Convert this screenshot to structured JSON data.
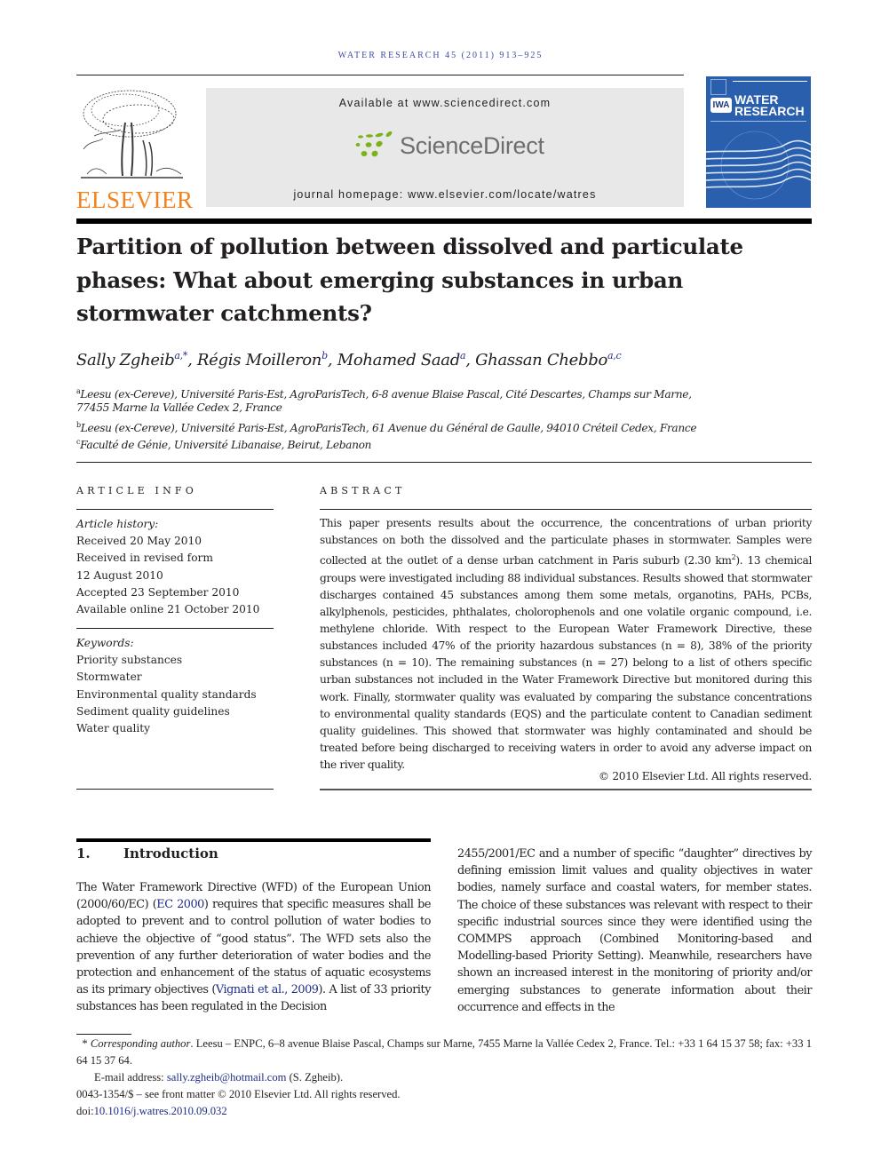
{
  "header": {
    "journal_citation": "WATER RESEARCH 45 (2011) 913–925",
    "available_at": "Available at www.sciencedirect.com",
    "sciencedirect_logo_text": "ScienceDirect",
    "journal_homepage": "journal homepage: www.elsevier.com/locate/watres",
    "publisher_logo_text": "ELSEVIER",
    "cover": {
      "badge": "IWA",
      "title_line1": "WATER",
      "title_line2": "RESEARCH"
    },
    "colors": {
      "elsevier_orange": "#f2821e",
      "sciencedirect_green": "#7ab317",
      "cover_blue": "#2a5fae",
      "link_blue": "#1f2d8a"
    }
  },
  "article": {
    "title": "Partition of pollution between dissolved and particulate phases: What about emerging substances in urban stormwater catchments?",
    "authors": [
      {
        "name": "Sally Zgheib",
        "affil": "a,*"
      },
      {
        "name": "Régis Moilleron",
        "affil": "b"
      },
      {
        "name": "Mohamed Saad",
        "affil": "a"
      },
      {
        "name": "Ghassan Chebbo",
        "affil": "a,c"
      }
    ],
    "affiliations": [
      {
        "mark": "a",
        "line1": "Leesu (ex-Cereve), Université Paris-Est, AgroParisTech, 6-8 avenue Blaise Pascal, Cité Descartes, Champs sur Marne,",
        "line2": "77455 Marne la Vallée Cedex 2, France"
      },
      {
        "mark": "b",
        "line1": "Leesu (ex-Cereve), Université Paris-Est, AgroParisTech, 61 Avenue du Général de Gaulle, 94010 Créteil Cedex, France"
      },
      {
        "mark": "c",
        "line1": "Faculté de Génie, Université Libanaise, Beirut, Lebanon"
      }
    ]
  },
  "article_info": {
    "heading": "ARTICLE INFO",
    "history_label": "Article history:",
    "history": [
      "Received 20 May 2010",
      "Received in revised form",
      "12 August 2010",
      "Accepted 23 September 2010",
      "Available online 21 October 2010"
    ],
    "keywords_label": "Keywords:",
    "keywords": [
      "Priority substances",
      "Stormwater",
      "Environmental quality standards",
      "Sediment quality guidelines",
      "Water quality"
    ]
  },
  "abstract": {
    "heading": "ABSTRACT",
    "text_part1": "This paper presents results about the occurrence, the concentrations of urban priority substances on both the dissolved and the particulate phases in stormwater. Samples were collected at the outlet of a dense urban catchment in Paris suburb (2.30 km",
    "text_sup": "2",
    "text_part2": "). 13 chemical groups were investigated including 88 individual substances. Results showed that stormwater discharges contained 45 substances among them some metals, organotins, PAHs, PCBs, alkylphenols, pesticides, phthalates, cholorophenols and one volatile organic compound, i.e. methylene chloride. With respect to the European Water Framework Directive, these substances included 47% of the priority hazardous substances (n = 8), 38% of the priority substances (n = 10). The remaining substances (n = 27) belong to a list of others specific urban substances not included in the Water Framework Directive but monitored during this work. Finally, stormwater quality was evaluated by comparing the substance concentrations to environmental quality standards (EQS) and the particulate content to Canadian sediment quality guidelines. This showed that stormwater was highly contaminated and should be treated before being discharged to receiving waters in order to avoid any adverse impact on the river quality.",
    "copyright": "© 2010 Elsevier Ltd. All rights reserved."
  },
  "introduction": {
    "number": "1.",
    "heading": "Introduction",
    "col1_a": "The Water Framework Directive (WFD) of the European Union (2000/60/EC) (",
    "col1_link1": "EC 2000",
    "col1_b": ") requires that specific measures shall be adopted to prevent and to control pollution of water bodies to achieve the objective of “good status”. The WFD sets also the prevention of any further deterioration of water bodies and the protection and enhancement of the status of aquatic ecosystems as its primary objectives (",
    "col1_link2": "Vignati et al., 2009",
    "col1_c": "). A list of 33 priority substances has been regulated in the Decision",
    "col2": "2455/2001/EC and a number of specific “daughter” directives by defining emission limit values and quality objectives in water bodies, namely surface and coastal waters, for member states. The choice of these substances was relevant with respect to their specific industrial sources since they were identified using the COMMPS approach (Combined Monitoring-based and Modelling-based Priority Setting). Meanwhile, researchers have shown an increased interest in the monitoring of priority and/or emerging substances to generate information about their occurrence and effects in the"
  },
  "footnotes": {
    "star": "*",
    "corresponding_label": "Corresponding author",
    "corresponding_text": ". Leesu – ENPC, 6–8 avenue Blaise Pascal, Champs sur Marne, 7455 Marne la Vallée Cedex 2, France. Tel.: +33 1 64 15 37 58; fax: +33 1 64 15 37 64.",
    "email_label": "E-mail address: ",
    "email": "sally.zgheib@hotmail.com",
    "email_suffix": " (S. Zgheib).",
    "issn_line": "0043-1354/$ – see front matter © 2010 Elsevier Ltd. All rights reserved.",
    "doi_label": "doi:",
    "doi": "10.1016/j.watres.2010.09.032"
  }
}
